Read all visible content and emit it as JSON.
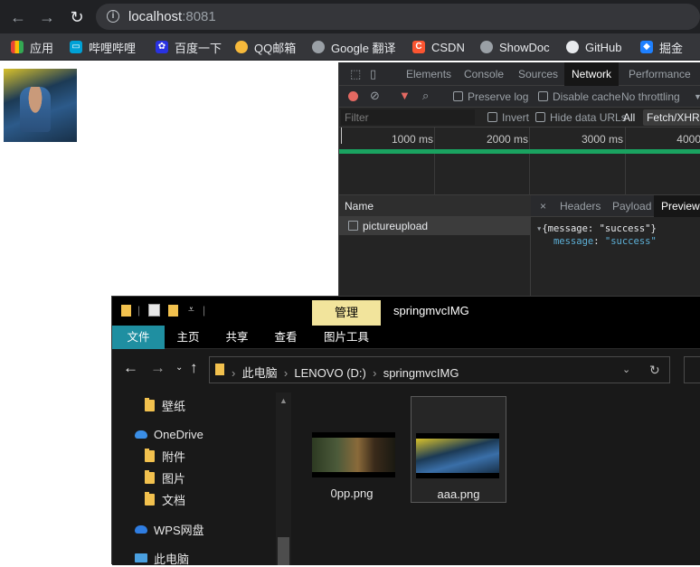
{
  "browser": {
    "url_host": "localhost",
    "url_port": ":8081",
    "bookmarks": [
      {
        "label": "应用",
        "icon": "apps-grid-icon",
        "color": "#f4b400"
      },
      {
        "label": "哔哩哔哩",
        "icon": "bilibili-icon",
        "color": "#00a1d6"
      },
      {
        "label": "百度一下",
        "icon": "baidu-paw-icon",
        "color": "#2932e1"
      },
      {
        "label": "QQ邮箱",
        "icon": "qq-mail-icon",
        "color": "#f6b93b"
      },
      {
        "label": "Google 翻译",
        "icon": "globe-icon",
        "color": "#9aa0a6"
      },
      {
        "label": "CSDN",
        "icon": "csdn-icon",
        "color": "#fc5531"
      },
      {
        "label": "ShowDoc",
        "icon": "globe-icon",
        "color": "#9aa0a6"
      },
      {
        "label": "GitHub",
        "icon": "github-icon",
        "color": "#e8eaed"
      },
      {
        "label": "掘金",
        "icon": "juejin-icon",
        "color": "#1e80ff"
      }
    ]
  },
  "devtools": {
    "tabs": [
      "Elements",
      "Console",
      "Sources",
      "Network",
      "Performance"
    ],
    "active_tab": "Network",
    "toolbar": {
      "preserve_log": "Preserve log",
      "disable_cache": "Disable cache",
      "throttling": "No throttling"
    },
    "filter": {
      "placeholder": "Filter",
      "invert": "Invert",
      "hide_data_urls": "Hide data URLs",
      "all": "All",
      "fetch_xhr": "Fetch/XHR"
    },
    "timeline_ticks": [
      "1000 ms",
      "2000 ms",
      "3000 ms",
      "4000"
    ],
    "name_header": "Name",
    "request_name": "pictureupload",
    "detail_tabs": [
      "Headers",
      "Payload",
      "Preview"
    ],
    "active_detail_tab": "Preview",
    "preview": {
      "summary_key": "message",
      "summary_value": "\"success\"",
      "key": "message",
      "value": "\"success\""
    }
  },
  "explorer": {
    "manage_tab": "管理",
    "folder_title": "springmvcIMG",
    "ribbon": [
      "文件",
      "主页",
      "共享",
      "查看",
      "图片工具"
    ],
    "breadcrumb": [
      "此电脑",
      "LENOVO (D:)",
      "springmvcIMG"
    ],
    "nav_items": [
      {
        "label": "壁纸",
        "icon": "folder-icon"
      },
      {
        "label": "OneDrive",
        "icon": "onedrive-cloud-icon"
      },
      {
        "label": "附件",
        "icon": "folder-icon"
      },
      {
        "label": "图片",
        "icon": "folder-icon"
      },
      {
        "label": "文档",
        "icon": "folder-icon"
      },
      {
        "label": "WPS网盘",
        "icon": "wps-cloud-icon"
      },
      {
        "label": "此电脑",
        "icon": "computer-icon"
      }
    ],
    "files": [
      {
        "name": "0pp.png",
        "selected": false
      },
      {
        "name": "aaa.png",
        "selected": true
      }
    ]
  }
}
